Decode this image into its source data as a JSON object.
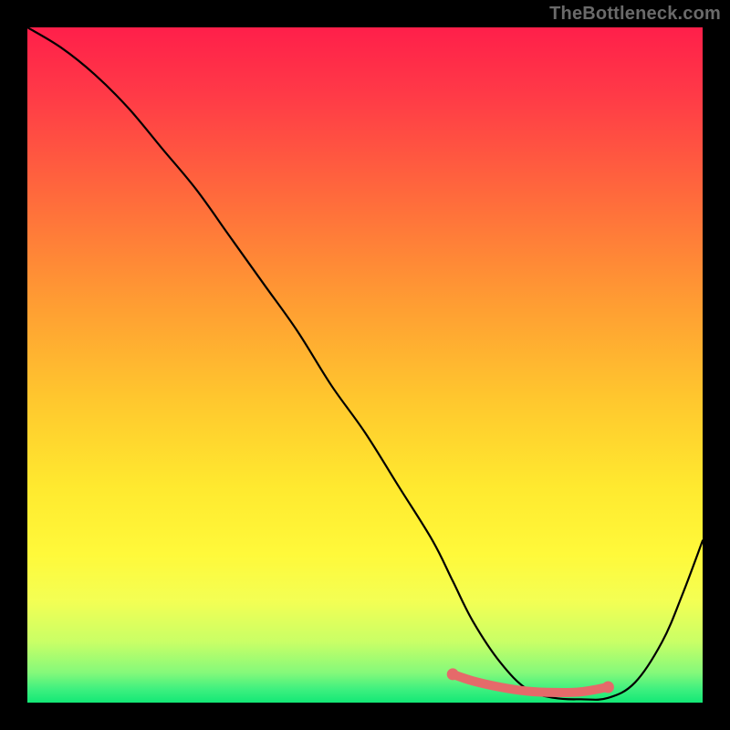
{
  "watermark": "TheBottleneck.com",
  "chart_data": {
    "type": "line",
    "title": "",
    "xlabel": "",
    "ylabel": "",
    "xlim": [
      0,
      100
    ],
    "ylim": [
      0,
      100
    ],
    "grid": false,
    "series": [
      {
        "name": "bottleneck-curve",
        "x": [
          0,
          5,
          10,
          15,
          20,
          25,
          30,
          35,
          40,
          45,
          50,
          55,
          60,
          63,
          66,
          70,
          74,
          78,
          82,
          86,
          90,
          94,
          97,
          100
        ],
        "values": [
          100,
          97,
          93,
          88,
          82,
          76,
          69,
          62,
          55,
          47,
          40,
          32,
          24,
          18,
          12,
          6,
          2,
          0.7,
          0.5,
          0.7,
          3,
          9,
          16,
          24
        ]
      }
    ],
    "accent_region": {
      "name": "optimal-range",
      "x": [
        63,
        66,
        70,
        74,
        78,
        82,
        86
      ],
      "values": [
        4.2,
        3.2,
        2.3,
        1.7,
        1.5,
        1.6,
        2.3
      ]
    },
    "gradient_colors": {
      "top": "#ff1f4a",
      "mid": "#ffe92f",
      "bottom": "#12e876"
    }
  }
}
